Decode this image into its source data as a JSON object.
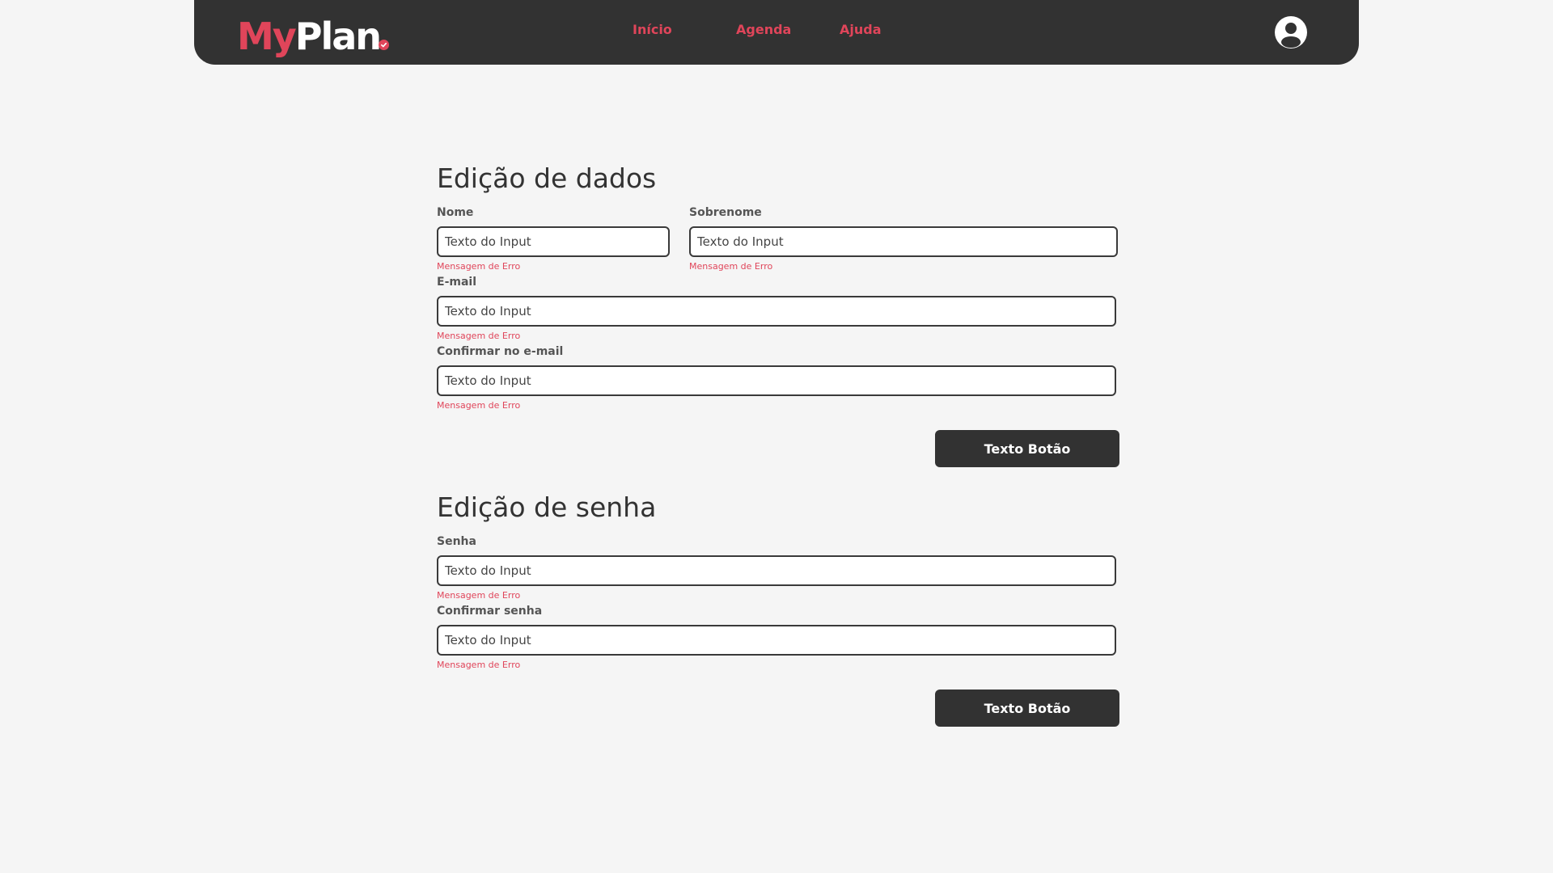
{
  "brand": {
    "logo_part1": "My",
    "logo_part2": "Plan",
    "accent_color": "#e0455a",
    "header_color": "#323232"
  },
  "nav": {
    "items": [
      {
        "label": "Início"
      },
      {
        "label": "Agenda"
      },
      {
        "label": "Ajuda"
      }
    ],
    "avatar_icon": "user-circle-icon"
  },
  "data_section": {
    "title": "Edição de dados",
    "fields": {
      "nome": {
        "label": "Nome",
        "placeholder": "Texto do Input",
        "error": "Mensagem de Erro"
      },
      "sobrenome": {
        "label": "Sobrenome",
        "placeholder": "Texto do Input",
        "error": "Mensagem de Erro"
      },
      "email": {
        "label": "E-mail",
        "placeholder": "Texto do Input",
        "error": "Mensagem de Erro"
      },
      "confirm_email": {
        "label": "Confirmar no e-mail",
        "placeholder": "Texto do Input",
        "error": "Mensagem de Erro"
      }
    },
    "button_label": "Texto Botão"
  },
  "password_section": {
    "title": "Edição de senha",
    "fields": {
      "senha": {
        "label": "Senha",
        "placeholder": "Texto do Input",
        "error": "Mensagem de Erro"
      },
      "confirm_senha": {
        "label": "Confirmar senha",
        "placeholder": "Texto do Input",
        "error": "Mensagem de Erro"
      }
    },
    "button_label": "Texto Botão"
  }
}
